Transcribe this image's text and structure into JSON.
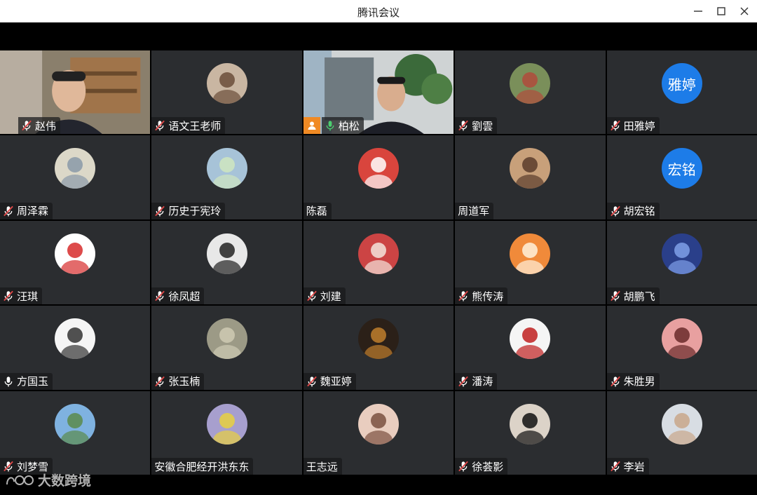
{
  "window": {
    "title": "腾讯会议"
  },
  "watermark": {
    "text": "大数跨境"
  },
  "colors": {
    "host_badge": "#f08a24",
    "speaking_border": "#3fb36b",
    "text_avatar": "#1d7ce8",
    "muted_icon": "#e04848"
  },
  "participants": [
    {
      "name": "赵伟",
      "mic": "muted",
      "kind": "video",
      "icon": "man-in-office-video"
    },
    {
      "name": "语文王老师",
      "mic": "muted",
      "kind": "avatar",
      "icon": "football-player-avatar"
    },
    {
      "name": "柏松",
      "mic": "on",
      "kind": "video",
      "icon": "man-in-suit-video",
      "host": true,
      "speaking": true
    },
    {
      "name": "劉雲",
      "mic": "muted",
      "kind": "avatar",
      "icon": "landscape-avatar"
    },
    {
      "name": "田雅婷",
      "mic": "muted",
      "kind": "text",
      "avatar_text": "雅婷"
    },
    {
      "name": "周泽霖",
      "mic": "muted",
      "kind": "avatar",
      "icon": "china-flag-tennis-avatar"
    },
    {
      "name": "历史于宪玲",
      "mic": "muted",
      "kind": "avatar",
      "icon": "child-photo-avatar"
    },
    {
      "name": "陈磊",
      "mic": "none",
      "kind": "avatar",
      "icon": "calligraphy-avatar"
    },
    {
      "name": "周道军",
      "mic": "none",
      "kind": "avatar",
      "icon": "panda-avatar"
    },
    {
      "name": "胡宏铭",
      "mic": "muted",
      "kind": "text",
      "avatar_text": "宏铭"
    },
    {
      "name": "汪琪",
      "mic": "muted",
      "kind": "avatar",
      "icon": "bear-toy-avatar"
    },
    {
      "name": "徐凤超",
      "mic": "muted",
      "kind": "avatar",
      "icon": "cartoon-dancer-avatar"
    },
    {
      "name": "刘建",
      "mic": "muted",
      "kind": "avatar",
      "icon": "city-skyline-avatar"
    },
    {
      "name": "熊传涛",
      "mic": "muted",
      "kind": "avatar",
      "icon": "meme-face-avatar"
    },
    {
      "name": "胡鹏飞",
      "mic": "muted",
      "kind": "avatar",
      "icon": "rock-avatar"
    },
    {
      "name": "方国玉",
      "mic": "on",
      "kind": "avatar",
      "icon": "pagoda-night-avatar"
    },
    {
      "name": "张玉楠",
      "mic": "muted",
      "kind": "avatar",
      "icon": "basketball-player-avatar"
    },
    {
      "name": "魏亚婷",
      "mic": "muted",
      "kind": "avatar",
      "icon": "woman-sunglasses-avatar"
    },
    {
      "name": "潘涛",
      "mic": "muted",
      "kind": "avatar",
      "icon": "road-trip-avatar"
    },
    {
      "name": "朱胜男",
      "mic": "muted",
      "kind": "avatar",
      "icon": "child-yellow-avatar"
    },
    {
      "name": "刘梦雪",
      "mic": "muted",
      "kind": "avatar",
      "icon": "mother-baby-avatar"
    },
    {
      "name": "安徽合肥经开洪东东",
      "mic": "none",
      "kind": "avatar",
      "icon": "man-sunglasses-avatar"
    },
    {
      "name": "王志远",
      "mic": "none",
      "kind": "avatar",
      "icon": "baby-avatar"
    },
    {
      "name": "徐荟影",
      "mic": "muted",
      "kind": "avatar",
      "icon": "illustration-avatar"
    },
    {
      "name": "李岩",
      "mic": "muted",
      "kind": "avatar",
      "icon": "plant-avatar"
    }
  ]
}
